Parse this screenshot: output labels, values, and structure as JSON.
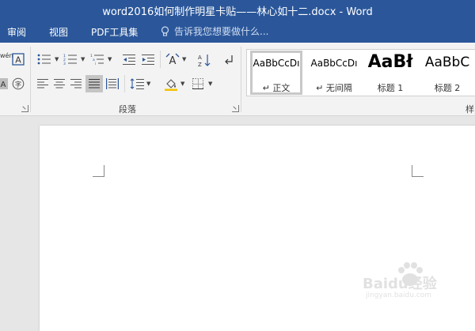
{
  "window": {
    "title": "word2016如何制作明星卡贴——林心如十二.docx - Word"
  },
  "tabs": [
    {
      "label": "审阅"
    },
    {
      "label": "视图"
    },
    {
      "label": "PDF工具集"
    }
  ],
  "tell_me": {
    "placeholder": "告诉我您想要做什么..."
  },
  "font_group": {
    "phonetic_label": "wén",
    "enclosed_char": "字"
  },
  "paragraph_group": {
    "label": "段落"
  },
  "styles_group": {
    "label": "样",
    "items": [
      {
        "preview": "AaBbCcDı",
        "name": "↵ 正文",
        "selected": true
      },
      {
        "preview": "AaBbCcDı",
        "name": "↵ 无间隔",
        "selected": false
      },
      {
        "preview": "AaBł",
        "name": "标题 1",
        "selected": false
      },
      {
        "preview": "AaBbC",
        "name": "标题 2",
        "selected": false
      }
    ]
  },
  "watermark": {
    "text": "Baidu经验",
    "sub": "jingyan.baidu.com"
  },
  "colors": {
    "accent": "#2b579a",
    "ribbon": "#f3f3f3",
    "canvas": "#e6e6e6"
  }
}
